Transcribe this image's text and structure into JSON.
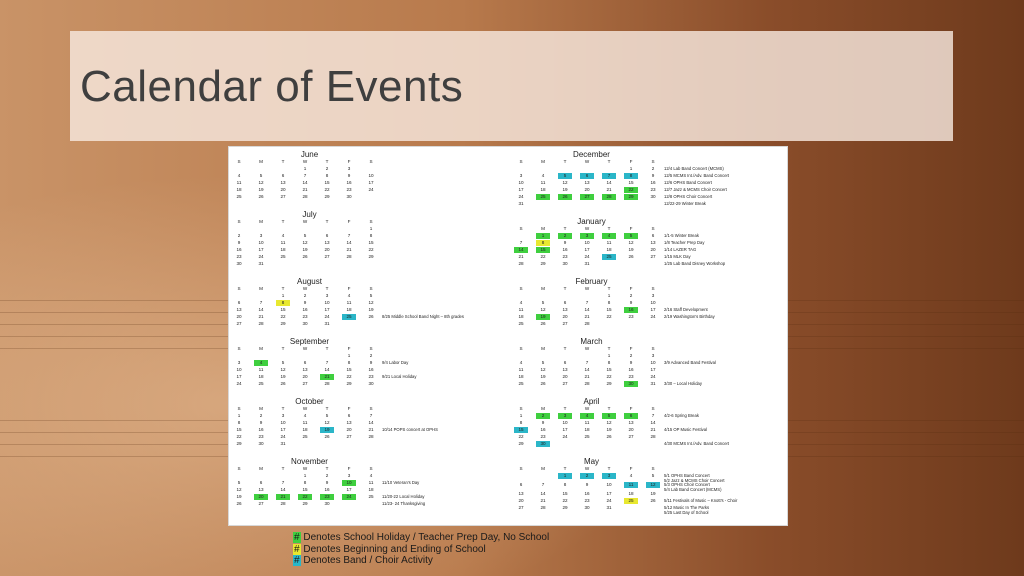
{
  "title": "Calendar of Events",
  "colors": {
    "holiday": "#3fcf3f",
    "school": "#e8e830",
    "band": "#2bb6c8"
  },
  "dow": [
    "S",
    "M",
    "T",
    "W",
    "T",
    "F",
    "S"
  ],
  "months": [
    {
      "name": "June",
      "col": 0,
      "weeks": [
        [
          "",
          "",
          "",
          "1",
          "2",
          "3"
        ],
        [
          "4",
          "5",
          "6",
          "7",
          "8",
          "9",
          "10"
        ],
        [
          "11",
          "12",
          "13",
          "14",
          "15",
          "16",
          "17"
        ],
        [
          "18",
          "19",
          "20",
          "21",
          "22",
          "23",
          "24"
        ],
        [
          "25",
          "26",
          "27",
          "28",
          "29",
          "30",
          ""
        ]
      ],
      "lead": [
        3
      ],
      "highlights": {},
      "events": []
    },
    {
      "name": "July",
      "col": 0,
      "weeks": [
        [
          "",
          "",
          "",
          "",
          "",
          "",
          "1"
        ],
        [
          "2",
          "3",
          "4",
          "5",
          "6",
          "7",
          "8"
        ],
        [
          "9",
          "10",
          "11",
          "12",
          "13",
          "14",
          "15"
        ],
        [
          "16",
          "17",
          "18",
          "19",
          "20",
          "21",
          "22"
        ],
        [
          "23",
          "24",
          "25",
          "26",
          "27",
          "28",
          "29"
        ],
        [
          "30",
          "31",
          "",
          "",
          "",
          "",
          ""
        ]
      ],
      "highlights": {},
      "events": []
    },
    {
      "name": "August",
      "col": 0,
      "weeks": [
        [
          "",
          "",
          "1",
          "2",
          "3",
          "4",
          "5"
        ],
        [
          "6",
          "7",
          "8",
          "9",
          "10",
          "11",
          "12"
        ],
        [
          "13",
          "14",
          "15",
          "16",
          "17",
          "18",
          "19"
        ],
        [
          "20",
          "21",
          "22",
          "23",
          "24",
          "25",
          "26"
        ],
        [
          "27",
          "28",
          "29",
          "30",
          "31",
          "",
          ""
        ]
      ],
      "highlights": {
        "1-2": "y",
        "3-5": "t"
      },
      "events": [
        {
          "w": 3,
          "t": "8/25 Middle School Band Night – 8th grades"
        }
      ]
    },
    {
      "name": "September",
      "col": 0,
      "weeks": [
        [
          "",
          "",
          "",
          "",
          "",
          "1",
          "2"
        ],
        [
          "3",
          "4",
          "5",
          "6",
          "7",
          "8",
          "9"
        ],
        [
          "10",
          "11",
          "12",
          "13",
          "14",
          "15",
          "16"
        ],
        [
          "17",
          "18",
          "19",
          "20",
          "21",
          "22",
          "23"
        ],
        [
          "24",
          "25",
          "26",
          "27",
          "28",
          "29",
          "30"
        ]
      ],
      "highlights": {
        "1-1": "g",
        "3-4": "g"
      },
      "events": [
        {
          "w": 1,
          "t": "9/4 Labor Day"
        },
        {
          "w": 3,
          "t": "9/21 Local Holiday"
        }
      ]
    },
    {
      "name": "October",
      "col": 0,
      "weeks": [
        [
          "1",
          "2",
          "3",
          "4",
          "5",
          "6",
          "7"
        ],
        [
          "8",
          "9",
          "10",
          "11",
          "12",
          "13",
          "14"
        ],
        [
          "15",
          "16",
          "17",
          "18",
          "19",
          "20",
          "21"
        ],
        [
          "22",
          "23",
          "24",
          "25",
          "26",
          "27",
          "28"
        ],
        [
          "29",
          "30",
          "31",
          "",
          "",
          "",
          ""
        ]
      ],
      "highlights": {
        "2-4": "t"
      },
      "events": [
        {
          "w": 2,
          "t": "10/14 POPS concert at OPHS"
        }
      ]
    },
    {
      "name": "November",
      "col": 0,
      "weeks": [
        [
          "",
          "",
          "",
          "1",
          "2",
          "3",
          "4"
        ],
        [
          "5",
          "6",
          "7",
          "8",
          "9",
          "10",
          "11"
        ],
        [
          "12",
          "13",
          "14",
          "15",
          "16",
          "17",
          "18"
        ],
        [
          "19",
          "20",
          "21",
          "22",
          "23",
          "24",
          "25"
        ],
        [
          "26",
          "27",
          "28",
          "29",
          "30",
          "",
          ""
        ]
      ],
      "highlights": {
        "1-5": "g",
        "3-1": "g",
        "3-2": "g",
        "3-3": "g",
        "3-4": "g",
        "3-5": "g"
      },
      "events": [
        {
          "w": 1,
          "t": "11/10 Veteran's Day"
        },
        {
          "w": 3,
          "t": "11/20-22 Local Holiday"
        },
        {
          "w": 4,
          "t": "11/23- 24 Thanksgiving"
        }
      ]
    },
    {
      "name": "December",
      "col": 1,
      "weeks": [
        [
          "",
          "",
          "",
          "",
          "",
          "1",
          "2"
        ],
        [
          "3",
          "4",
          "5",
          "6",
          "7",
          "8",
          "9"
        ],
        [
          "10",
          "11",
          "12",
          "13",
          "14",
          "15",
          "16"
        ],
        [
          "17",
          "18",
          "19",
          "20",
          "21",
          "22",
          "23"
        ],
        [
          "24",
          "25",
          "26",
          "27",
          "28",
          "29",
          "30"
        ],
        [
          "31",
          "",
          "",
          "",
          "",
          "",
          ""
        ]
      ],
      "highlights": {
        "1-2": "t",
        "1-3": "t",
        "1-4": "t",
        "1-5": "t",
        "3-5": "g",
        "4-1": "g",
        "4-2": "g",
        "4-3": "g",
        "4-4": "g",
        "4-5": "g"
      },
      "events": [
        {
          "w": 0,
          "t": "12/4 Lab Band Concert (MCMS)"
        },
        {
          "w": 1,
          "t": "12/5 MCMS Int./Adv. Band Concert"
        },
        {
          "w": 2,
          "t": "12/6 OPHS Band Concert"
        },
        {
          "w": 3,
          "t": "12/7 Jazz & MCMS Choir Concert"
        },
        {
          "w": 4,
          "t": "12/8 OPHS Choir Concert"
        },
        {
          "w": 5,
          "t": "12/22-29 Winter Break"
        }
      ]
    },
    {
      "name": "January",
      "col": 1,
      "weeks": [
        [
          "",
          "1",
          "2",
          "3",
          "4",
          "5",
          "6"
        ],
        [
          "7",
          "8",
          "9",
          "10",
          "11",
          "12",
          "13"
        ],
        [
          "14",
          "15",
          "16",
          "17",
          "18",
          "19",
          "20"
        ],
        [
          "21",
          "22",
          "23",
          "24",
          "25",
          "26",
          "27"
        ],
        [
          "28",
          "29",
          "30",
          "31",
          "",
          "",
          ""
        ]
      ],
      "highlights": {
        "0-1": "g",
        "0-2": "g",
        "0-3": "g",
        "0-4": "g",
        "0-5": "g",
        "1-1": "y",
        "2-0": "g",
        "2-1": "g",
        "3-4": "t"
      },
      "events": [
        {
          "w": 0,
          "t": "1/1-5 Winter Break"
        },
        {
          "w": 1,
          "t": "1/8 Teacher Prep Day"
        },
        {
          "w": 2,
          "t": "1/14 LAZER TAG"
        },
        {
          "w": 3,
          "t": "1/15 MLK Day"
        },
        {
          "w": 4,
          "t": "1/25 Lab Band Disney Workshop"
        }
      ]
    },
    {
      "name": "February",
      "col": 1,
      "weeks": [
        [
          "",
          "",
          "",
          "",
          "1",
          "2",
          "3"
        ],
        [
          "4",
          "5",
          "6",
          "7",
          "8",
          "9",
          "10"
        ],
        [
          "11",
          "12",
          "13",
          "14",
          "15",
          "16",
          "17"
        ],
        [
          "18",
          "19",
          "20",
          "21",
          "22",
          "23",
          "24"
        ],
        [
          "25",
          "26",
          "27",
          "28",
          "",
          "",
          ""
        ]
      ],
      "highlights": {
        "2-5": "g",
        "3-1": "g"
      },
      "events": [
        {
          "w": 2,
          "t": "2/16 Staff Development"
        },
        {
          "w": 3,
          "t": "2/19 Washington's Birthday"
        }
      ]
    },
    {
      "name": "March",
      "col": 1,
      "weeks": [
        [
          "",
          "",
          "",
          "",
          "1",
          "2",
          "3"
        ],
        [
          "4",
          "5",
          "6",
          "7",
          "8",
          "9",
          "10"
        ],
        [
          "11",
          "12",
          "13",
          "14",
          "15",
          "16",
          "17"
        ],
        [
          "18",
          "19",
          "20",
          "21",
          "22",
          "23",
          "24"
        ],
        [
          "25",
          "26",
          "27",
          "28",
          "29",
          "30",
          "31"
        ]
      ],
      "highlights": {
        "4-5": "g"
      },
      "events": [
        {
          "w": 1,
          "t": "3/9 Advanced Band Festival"
        },
        {
          "w": 4,
          "t": "3/30 – Local Holiday"
        }
      ]
    },
    {
      "name": "April",
      "col": 1,
      "weeks": [
        [
          "1",
          "2",
          "3",
          "4",
          "5",
          "6",
          "7"
        ],
        [
          "8",
          "9",
          "10",
          "11",
          "12",
          "13",
          "14"
        ],
        [
          "15",
          "16",
          "17",
          "18",
          "19",
          "20",
          "21"
        ],
        [
          "22",
          "23",
          "24",
          "25",
          "26",
          "27",
          "28"
        ],
        [
          "29",
          "30",
          "",
          "",
          "",
          "",
          ""
        ]
      ],
      "highlights": {
        "0-1": "g",
        "0-2": "g",
        "0-3": "g",
        "0-4": "g",
        "0-5": "g",
        "2-0": "t",
        "4-1": "t"
      },
      "events": [
        {
          "w": 0,
          "t": "4/2-6 Spring Break"
        },
        {
          "w": 2,
          "t": "4/15 OP Music Festival"
        },
        {
          "w": 4,
          "t": "4/30 MCMS Int./Adv. Band Concert"
        }
      ]
    },
    {
      "name": "May",
      "col": 1,
      "weeks": [
        [
          "",
          "",
          "1",
          "2",
          "3",
          "4",
          "5"
        ],
        [
          "6",
          "7",
          "8",
          "9",
          "10",
          "11",
          "12"
        ],
        [
          "13",
          "14",
          "15",
          "16",
          "17",
          "18",
          "19"
        ],
        [
          "20",
          "21",
          "22",
          "23",
          "24",
          "25",
          "26"
        ],
        [
          "27",
          "28",
          "29",
          "30",
          "31",
          "",
          ""
        ]
      ],
      "highlights": {
        "0-2": "t",
        "0-3": "t",
        "0-4": "t",
        "1-5": "t",
        "1-6": "t",
        "3-5": "y"
      },
      "events": [
        {
          "w": 0,
          "t": "5/1 OPHS Band Concert"
        },
        {
          "w": 0,
          "t": "5/2 Jazz & MCMS Choir Concert"
        },
        {
          "w": 1,
          "t": "5/3 OPHS Choir Concert"
        },
        {
          "w": 1,
          "t": "5/4 Lab Band Concert (MCMS)"
        },
        {
          "w": 3,
          "t": "5/11 Festivals of Music – Knott's - Choir"
        },
        {
          "w": 4,
          "t": "5/12 Music In The Parks"
        },
        {
          "w": 4,
          "t": "5/25 Last Day of School"
        }
      ]
    }
  ],
  "legend": [
    {
      "sw": "g",
      "text": "Denotes School Holiday / Teacher Prep Day, No School"
    },
    {
      "sw": "y",
      "text": "Denotes Beginning and Ending of School"
    },
    {
      "sw": "t",
      "text": "Denotes Band / Choir Activity"
    }
  ],
  "legend_symbol": "#"
}
